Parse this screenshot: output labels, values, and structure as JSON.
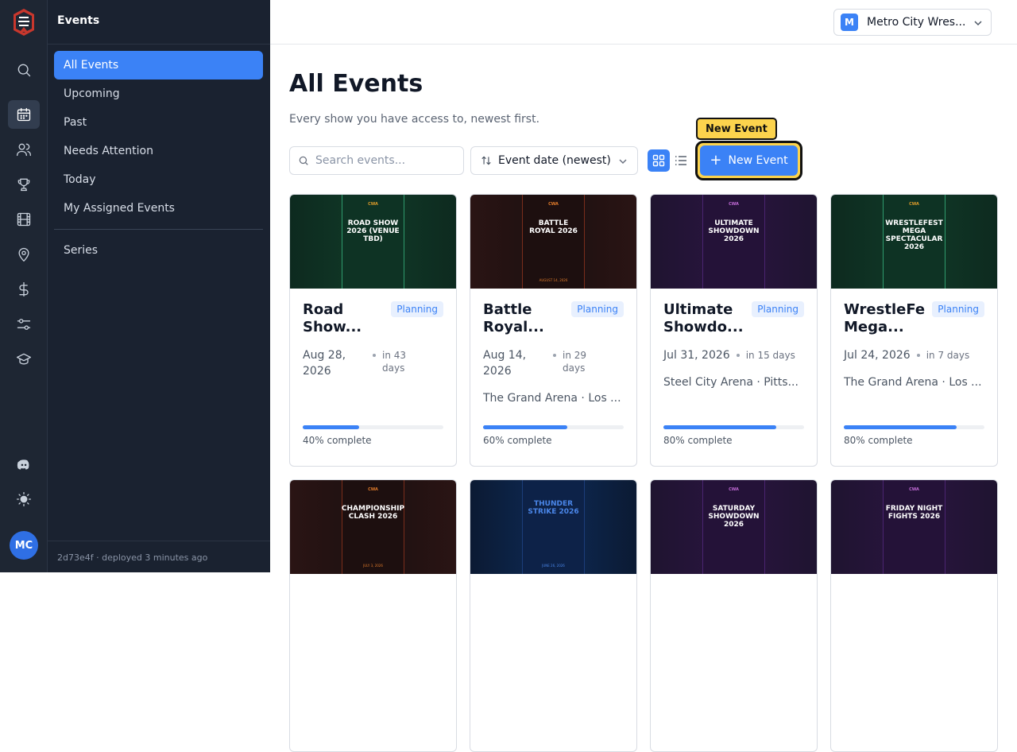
{
  "sidebar": {
    "title": "Events",
    "items": [
      {
        "label": "All Events",
        "active": true
      },
      {
        "label": "Upcoming"
      },
      {
        "label": "Past"
      },
      {
        "label": "Needs Attention"
      },
      {
        "label": "Today"
      },
      {
        "label": "My Assigned Events"
      }
    ],
    "series_label": "Series",
    "footer": "2d73e4f  · deployed 3 minutes ago"
  },
  "rail": {
    "avatar": "MC",
    "icons": [
      "logo-icon",
      "search-icon",
      "calendar-icon",
      "users-icon",
      "trophy-icon",
      "film-icon",
      "map-pin-icon",
      "dollar-icon",
      "sliders-icon",
      "graduation-cap-icon",
      "discord-icon",
      "sun-icon"
    ]
  },
  "org": {
    "initial": "M",
    "name": "Metro City Wres..."
  },
  "page": {
    "title": "All Events",
    "subtitle": "Every show you have access to, newest first."
  },
  "toolbar": {
    "search_placeholder": "Search events...",
    "sort_label": "Event date (newest)",
    "tooltip": "New Event",
    "new_event_label": "New Event"
  },
  "colors": {
    "accent": "#3b82f6",
    "highlight": "#fcd34d",
    "sidebar": "#1a2230"
  },
  "events": [
    {
      "name": "Road Show...",
      "status": "Planning",
      "date": "Aug 28, 2026",
      "relative": "in 43 days",
      "venue": "",
      "progress": 40,
      "progress_label": "40% complete",
      "poster": {
        "brand": "CWA",
        "title": "ROAD SHOW 2026 (VENUE TBD)",
        "date": "",
        "theme": "green"
      }
    },
    {
      "name": "Battle Royal...",
      "status": "Planning",
      "date": "Aug 14, 2026",
      "relative": "in 29 days",
      "venue": "The Grand Arena · Los ...",
      "progress": 60,
      "progress_label": "60% complete",
      "poster": {
        "brand": "CWA",
        "title": "BATTLE ROYAL 2026",
        "date": "AUGUST 14, 2026",
        "theme": "red"
      }
    },
    {
      "name": "Ultimate Showdo...",
      "status": "Planning",
      "date": "Jul 31, 2026",
      "relative": "in 15 days",
      "venue": "Steel City Arena · Pitts...",
      "progress": 80,
      "progress_label": "80% complete",
      "poster": {
        "brand": "CWA",
        "title": "ULTIMATE SHOWDOWN 2026",
        "date": "",
        "theme": "purple"
      }
    },
    {
      "name": "WrestleFe Mega...",
      "status": "Planning",
      "date": "Jul 24, 2026",
      "relative": "in 7 days",
      "venue": "The Grand Arena · Los ...",
      "progress": 80,
      "progress_label": "80% complete",
      "poster": {
        "brand": "CWA",
        "title": "WRESTLEFEST MEGA SPECTACULAR 2026",
        "date": "",
        "theme": "green"
      }
    },
    {
      "name": "",
      "status": "",
      "date": "",
      "relative": "",
      "venue": "",
      "progress": 0,
      "progress_label": "",
      "poster": {
        "brand": "CWA",
        "title": "CHAMPIONSHIP CLASH 2026",
        "date": "JULY 3, 2026",
        "theme": "red"
      }
    },
    {
      "name": "",
      "status": "",
      "date": "",
      "relative": "",
      "venue": "",
      "progress": 0,
      "progress_label": "",
      "poster": {
        "brand": "",
        "title": "THUNDER STRIKE 2026",
        "date": "JUNE 26, 2026",
        "theme": "blue"
      }
    },
    {
      "name": "",
      "status": "",
      "date": "",
      "relative": "",
      "venue": "",
      "progress": 0,
      "progress_label": "",
      "poster": {
        "brand": "CWA",
        "title": "SATURDAY SHOWDOWN 2026",
        "date": "",
        "theme": "purple"
      }
    },
    {
      "name": "",
      "status": "",
      "date": "",
      "relative": "",
      "venue": "",
      "progress": 0,
      "progress_label": "",
      "poster": {
        "brand": "CWA",
        "title": "FRIDAY NIGHT FIGHTS 2026",
        "date": "",
        "theme": "purple"
      }
    }
  ]
}
